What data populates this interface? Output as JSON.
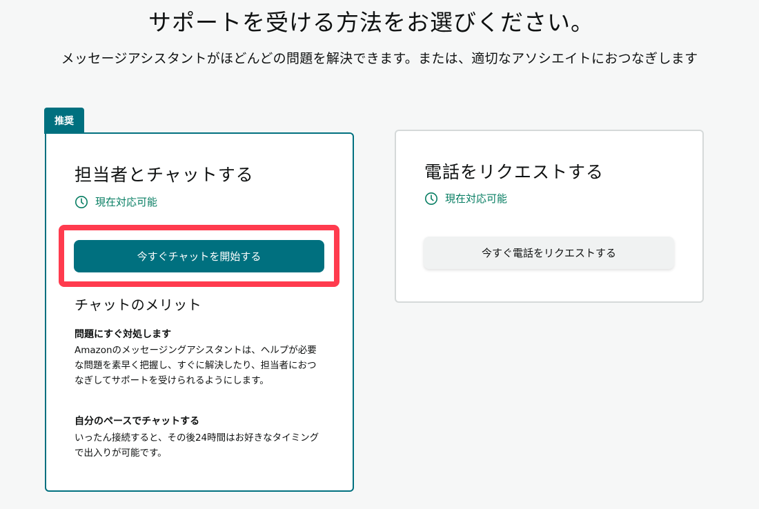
{
  "header": {
    "title": "サポートを受ける方法をお選びください。",
    "subtitle": "メッセージアシスタントがほどんどの問題を解決できます。または、適切なアソシエイトにおつなぎします"
  },
  "chat_card": {
    "badge": "推奨",
    "title": "担当者とチャットする",
    "availability": "現在対応可能",
    "button_label": "今すぐチャットを開始する",
    "benefits_title": "チャットのメリット",
    "benefits": [
      {
        "heading": "問題にすぐ対処します",
        "text": "Amazonのメッセージングアシスタントは、ヘルプが必要な問題を素早く把握し、すぐに解決したり、担当者におつなぎしてサポートを受けられるようにします。"
      },
      {
        "heading": "自分のペースでチャットする",
        "text": "いったん接続すると、その後24時間はお好きなタイミングで出入りが可能です。"
      }
    ]
  },
  "phone_card": {
    "title": "電話をリクエストする",
    "availability": "現在対応可能",
    "button_label": "今すぐ電話をリクエストする"
  },
  "icons": {
    "availability": "clock-icon"
  },
  "colors": {
    "brand_teal": "#00707f",
    "available_green": "#067d62",
    "highlight_red": "#ff3b4e"
  }
}
